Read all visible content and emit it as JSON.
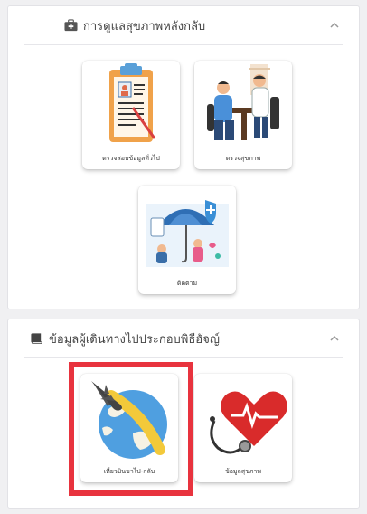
{
  "sections": [
    {
      "title": "การดูแลสุขภาพหลังกลับ",
      "icon": "medical-kit-icon",
      "cards": [
        {
          "label": "ตรวจสอบข้อมูลทั่วไป",
          "icon": "clipboard-profile-icon"
        },
        {
          "label": "ตรวจสุขภาพ",
          "icon": "doctor-checkup-icon"
        },
        {
          "label": "ติดตาม",
          "icon": "umbrella-protection-icon"
        }
      ]
    },
    {
      "title": "ข้อมูลผู้เดินทางไปประกอบพิธีฮัจญ์",
      "icon": "book-icon",
      "cards": [
        {
          "label": "เที่ยวบินขาไป-กลับ",
          "icon": "airplane-globe-icon"
        },
        {
          "label": "ข้อมูลสุขภาพ",
          "icon": "heart-stethoscope-icon"
        }
      ]
    }
  ],
  "colors": {
    "highlight": "#e8333e",
    "accent": "#3a8fd6",
    "heart": "#d92b2b"
  }
}
